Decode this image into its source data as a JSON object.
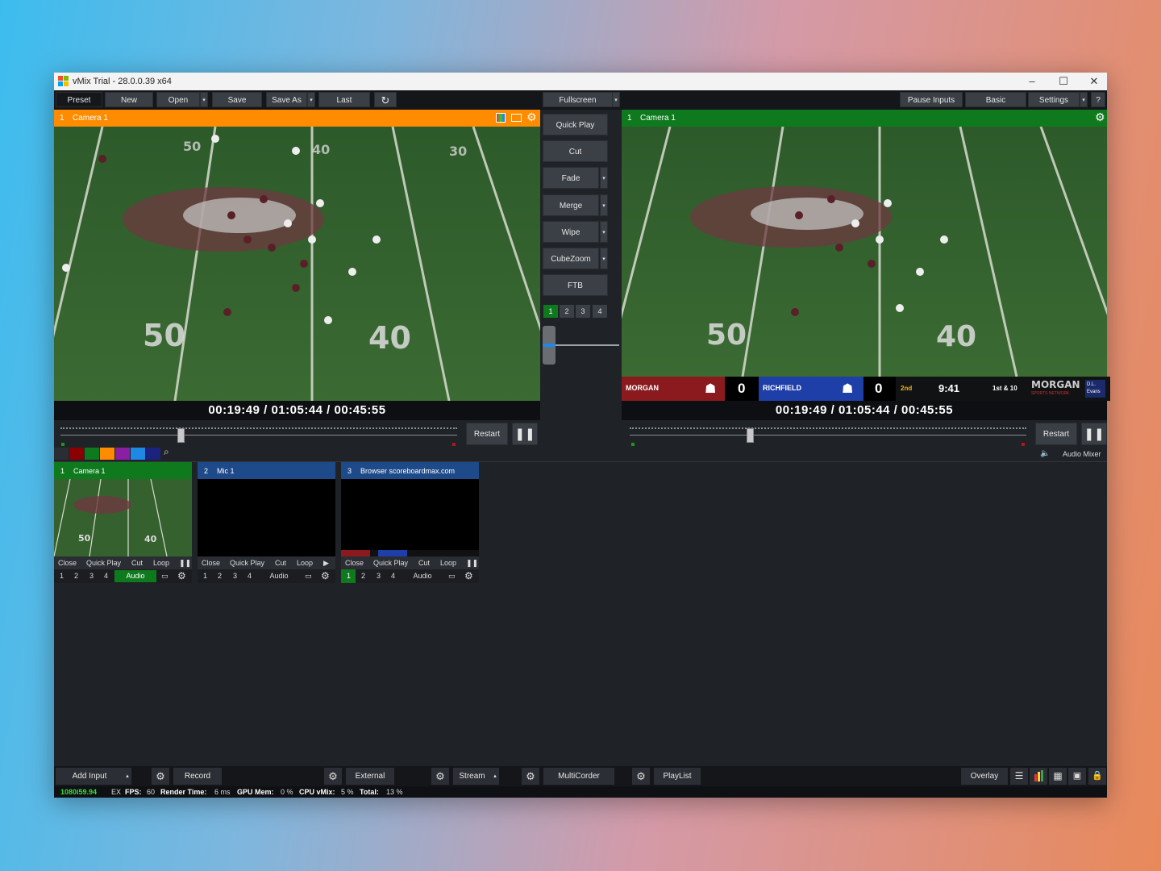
{
  "window": {
    "title": "vMix Trial - 28.0.0.39 x64"
  },
  "toolbar": {
    "preset": "Preset",
    "new": "New",
    "open": "Open",
    "save": "Save",
    "save_as": "Save As",
    "last": "Last",
    "fullscreen": "Fullscreen",
    "pause_inputs": "Pause Inputs",
    "basic": "Basic",
    "settings": "Settings",
    "help": "?"
  },
  "preview": {
    "number": "1",
    "name": "Camera 1",
    "timecode": "00:19:49  /  01:05:44  /  00:45:55",
    "restart": "Restart"
  },
  "output": {
    "number": "1",
    "name": "Camera 1",
    "timecode": "00:19:49  /  01:05:44  /  00:45:55",
    "restart": "Restart",
    "audio_mixer": "Audio Mixer"
  },
  "transitions": {
    "quick_play": "Quick Play",
    "cut": "Cut",
    "fade": "Fade",
    "merge": "Merge",
    "wipe": "Wipe",
    "cubezoom": "CubeZoom",
    "ftb": "FTB",
    "numbers": [
      "1",
      "2",
      "3",
      "4"
    ]
  },
  "scoreboard": {
    "home": "MORGAN",
    "home_score": "0",
    "away": "RICHFIELD",
    "away_score": "0",
    "period": "2nd",
    "clock": "9:41",
    "down": "1st & 10",
    "sponsor": "MORGAN",
    "sponsor_sub": "SPORTS NETWORK",
    "sponsor2": "D.L. Evans"
  },
  "field": {
    "n50": "50",
    "n40": "40",
    "top40": "40",
    "top30": "30",
    "top50": "50"
  },
  "inputs": [
    {
      "number": "1",
      "name": "Camera 1",
      "controls": [
        "Close",
        "Quick Play",
        "Cut",
        "Loop"
      ],
      "nums": [
        "1",
        "2",
        "3",
        "4"
      ],
      "audio": "Audio"
    },
    {
      "number": "2",
      "name": "Mic 1",
      "controls": [
        "Close",
        "Quick Play",
        "Cut",
        "Loop"
      ],
      "nums": [
        "1",
        "2",
        "3",
        "4"
      ],
      "audio": "Audio"
    },
    {
      "number": "3",
      "name": "Browser scoreboardmax.com",
      "controls": [
        "Close",
        "Quick Play",
        "Cut",
        "Loop"
      ],
      "nums": [
        "1",
        "2",
        "3",
        "4"
      ],
      "audio": "Audio"
    }
  ],
  "bottom": {
    "add_input": "Add Input",
    "record": "Record",
    "external": "External",
    "stream": "Stream",
    "multicorder": "MultiCorder",
    "playlist": "PlayList",
    "overlay": "Overlay"
  },
  "status": {
    "resolution": "1080i59.94",
    "ex": "EX",
    "fps_label": "FPS:",
    "fps": "60",
    "render_label": "Render Time:",
    "render": "6 ms",
    "gpu_label": "GPU Mem:",
    "gpu": "0 %",
    "cpu_label": "CPU vMix:",
    "cpu": "5 %",
    "total_label": "Total:",
    "total": "13 %"
  },
  "colors": {
    "preview_accent": "#ff8c00",
    "output_accent": "#0f7a1d",
    "input_active": "#0f7a1d",
    "input_blue": "#1f4a8a",
    "tags": [
      "#8b0000",
      "#0f7a1d",
      "#ff8c00",
      "#8a1fa3",
      "#1e88e5",
      "#1a237e"
    ]
  }
}
